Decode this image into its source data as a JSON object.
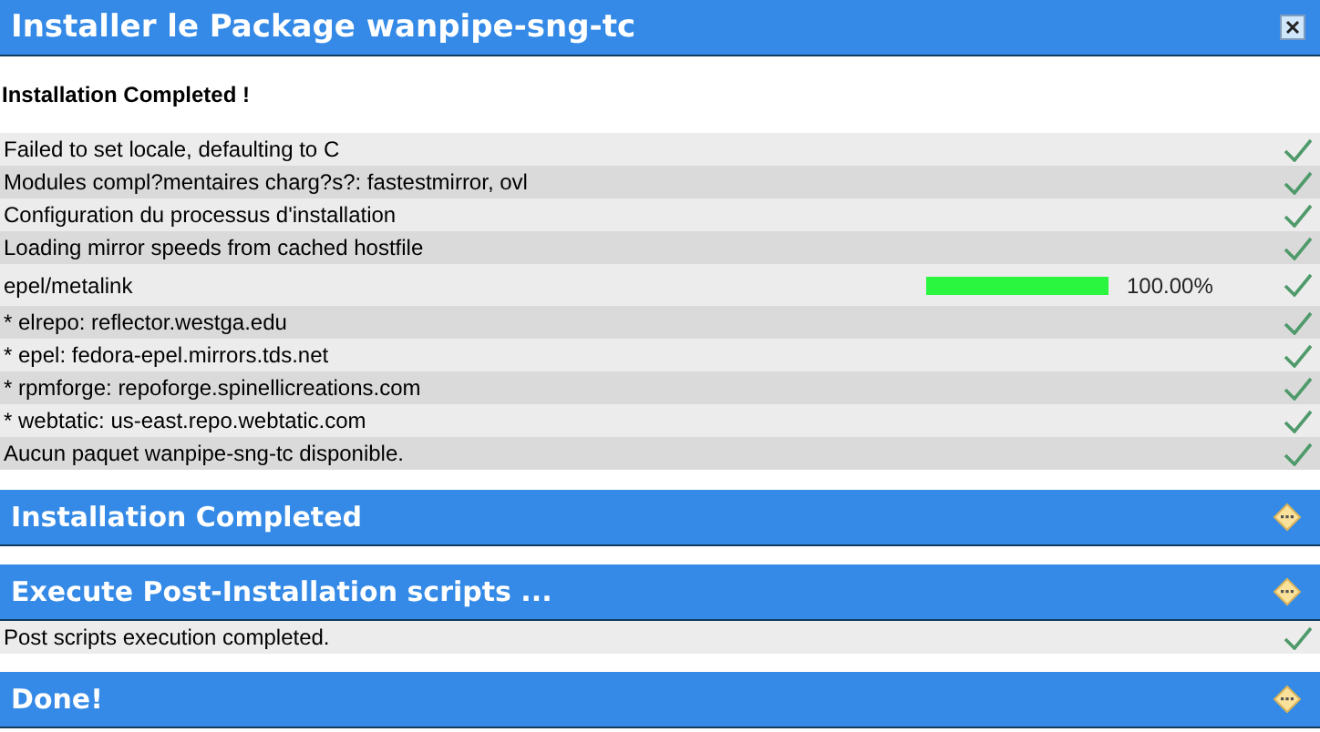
{
  "window": {
    "title": "Installer le Package wanpipe-sng-tc"
  },
  "status": "Installation Completed !",
  "log": [
    {
      "text": "Failed to set locale, defaulting to C",
      "done": true
    },
    {
      "text": "Modules compl?mentaires charg?s?: fastestmirror, ovl",
      "done": true
    },
    {
      "text": "Configuration du processus d'installation",
      "done": true
    },
    {
      "text": "Loading mirror speeds from cached hostfile",
      "done": true
    },
    {
      "text": "epel/metalink",
      "done": true,
      "progress": {
        "level": 1,
        "reading": "100.00%"
      }
    },
    {
      "text": "* elrepo: reflector.westga.edu",
      "done": true
    },
    {
      "text": "* epel: fedora-epel.mirrors.tds.net",
      "done": true
    },
    {
      "text": "* rpmforge: repoforge.spinellicreations.com",
      "done": true
    },
    {
      "text": "* webtatic: us-east.repo.webtatic.com",
      "done": true
    },
    {
      "text": "Aucun paquet wanpipe-sng-tc disponible.",
      "done": true
    }
  ],
  "sections": [
    {
      "title": "Installation Completed",
      "pending": true
    },
    {
      "title": "Execute Post-Installation scripts ...",
      "pending": true,
      "lines": [
        {
          "text": "Post scripts execution completed.",
          "done": true
        }
      ]
    },
    {
      "title": "Done!",
      "pending": true
    }
  ]
}
